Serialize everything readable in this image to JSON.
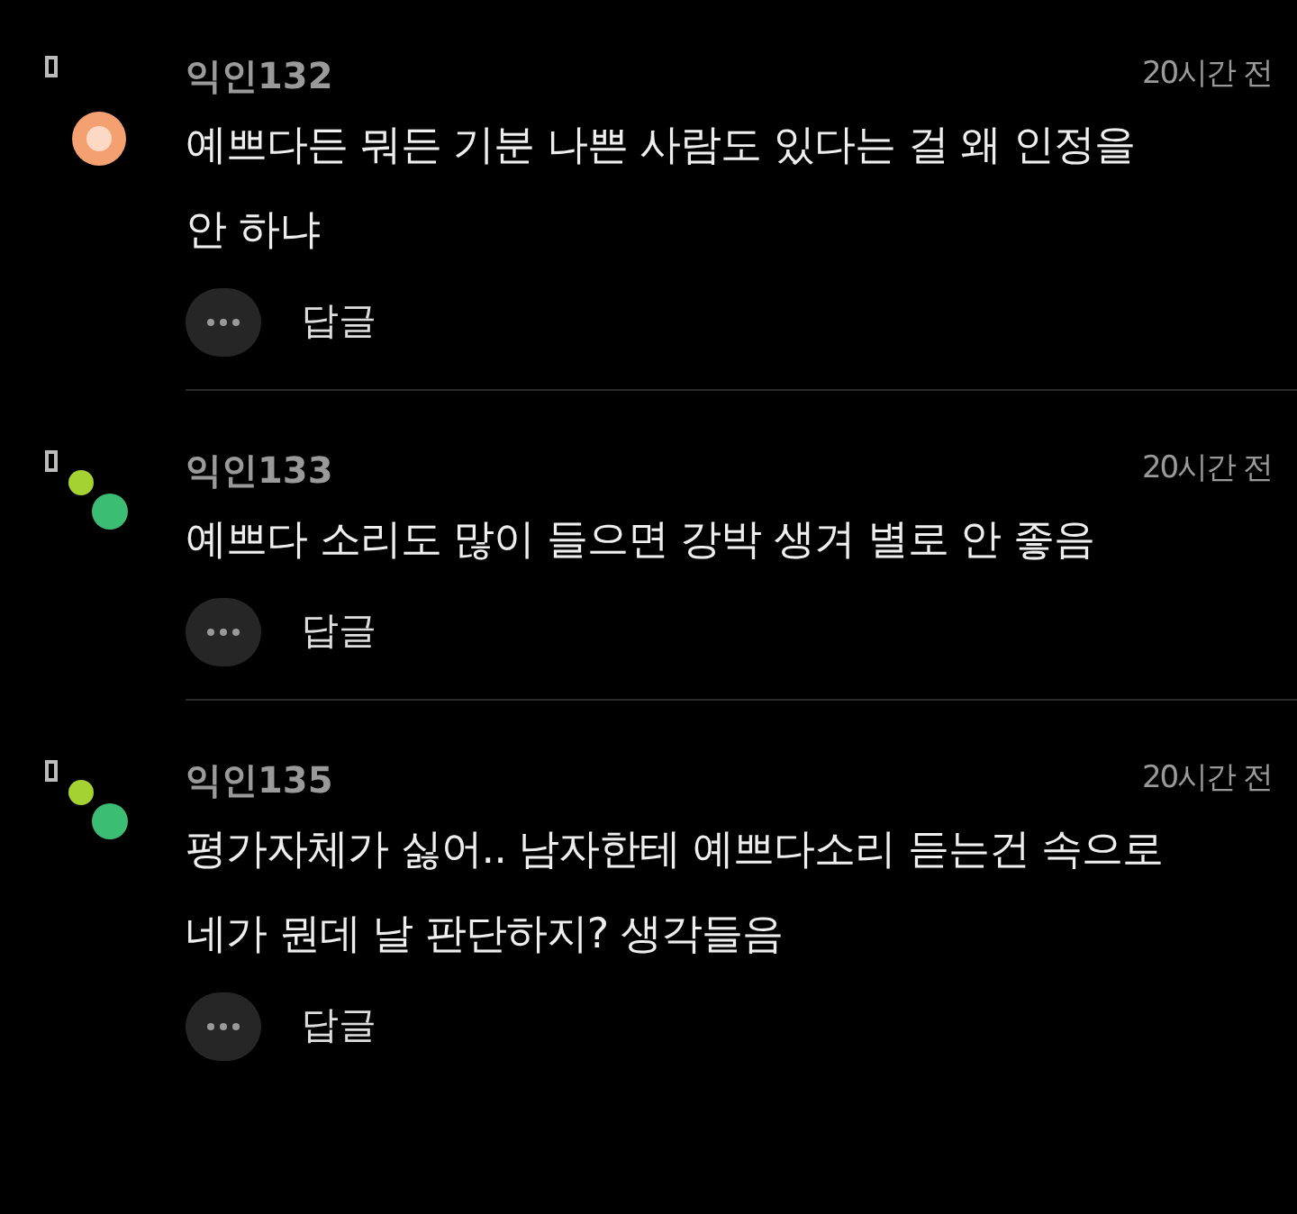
{
  "comments": [
    {
      "author": "익인132",
      "time": "20시간 전",
      "avatar": {
        "kind": "single",
        "dots": [
          {
            "color": "#f4a070"
          }
        ]
      },
      "lines": [
        "예쁘다든 뭐든 기분 나쁜 사람도 있다는 걸 왜 인정을",
        "안 하냐"
      ],
      "reply": "답글"
    },
    {
      "author": "익인133",
      "time": "20시간 전",
      "avatar": {
        "kind": "pair",
        "dots": [
          {
            "color": "#a4d232"
          },
          {
            "color": "#3cbd74"
          }
        ]
      },
      "lines": [
        "예쁘다 소리도 많이 들으면 강박 생겨 별로 안 좋음"
      ],
      "reply": "답글"
    },
    {
      "author": "익인135",
      "time": "20시간 전",
      "avatar": {
        "kind": "pair",
        "dots": [
          {
            "color": "#a4d232"
          },
          {
            "color": "#3cbd74"
          }
        ]
      },
      "lines": [
        "평가자체가 싫어.. 남자한테 예쁘다소리 듣는건 속으로",
        "네가 뭔데 날 판단하지? 생각들음"
      ],
      "reply": "답글"
    }
  ]
}
